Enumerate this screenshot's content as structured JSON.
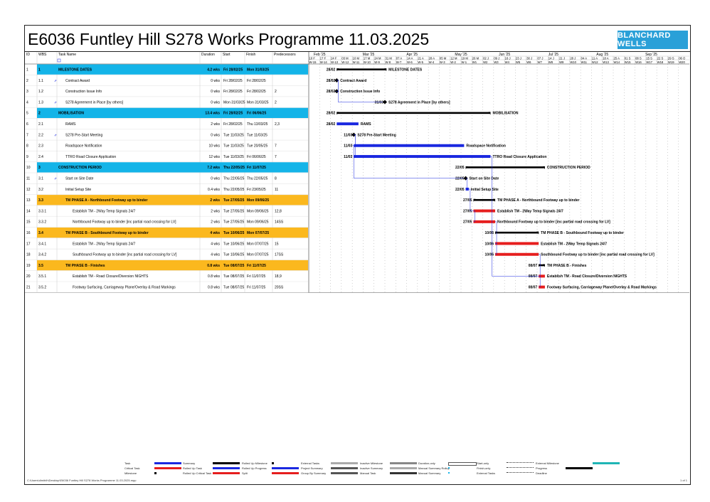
{
  "title": "E6036 Funtley Hill S278 Works Programme 11.03.2025",
  "logo_text": "BLANCHARD WELLS",
  "table_headers": {
    "id": "ID",
    "wbs": "WBS",
    "name": "Task Name",
    "duration": "Duration",
    "start": "Start",
    "finish": "Finish",
    "predecessors": "Predecessors"
  },
  "months": [
    "Feb '25",
    "Mar '25",
    "Apr '25",
    "May '25",
    "Jun '25",
    "Jul '25",
    "Aug '25",
    "Sep '25"
  ],
  "week_dates": [
    "10 F",
    "17 F",
    "24 F",
    "03 M",
    "10 M",
    "17 M",
    "24 M",
    "31 M",
    "07 A",
    "14 A",
    "21 A",
    "28 A",
    "05 M",
    "12 M",
    "19 M",
    "26 M",
    "02 J",
    "09 J",
    "16 J",
    "23 J",
    "30 J",
    "07 J",
    "14 J",
    "21 J",
    "28 J",
    "04 A",
    "11 A",
    "18 A",
    "25 A",
    "01 S",
    "08 S",
    "15 S",
    "22 S",
    "29 S",
    "06 O"
  ],
  "week_labels": [
    "W-15",
    "W-14",
    "W-13",
    "W-12",
    "W-11",
    "W-10",
    "W-9",
    "W-8",
    "W-7",
    "W-6",
    "W-5",
    "W-4",
    "W-3",
    "W-2",
    "W-1",
    "W1",
    "W2",
    "W3",
    "W4",
    "W5",
    "W6",
    "W7",
    "W8",
    "W9",
    "W10",
    "W11",
    "W12",
    "W13",
    "W14",
    "W15",
    "W16",
    "W17",
    "W18",
    "W19",
    "W20"
  ],
  "tasks": [
    {
      "id": "1",
      "wbs": "1",
      "name": "MILESTONE DATES",
      "duration": "4.2 wks",
      "start": "Fri 28/02/25",
      "finish": "Mon 31/03/25",
      "pred": "",
      "type": "summary-blue",
      "bar_label": "28/02",
      "label": "MILESTONE DATES"
    },
    {
      "id": "2",
      "wbs": "1.1",
      "name": "Contract Award",
      "duration": "0 wks",
      "start": "Fri 28/02/25",
      "finish": "Fri 28/02/25",
      "pred": "",
      "type": "milestone",
      "bar_label": "28/02",
      "label": "Contract Award"
    },
    {
      "id": "3",
      "wbs": "1.2",
      "name": "Construction Issue Info",
      "duration": "0 wks",
      "start": "Fri 28/02/25",
      "finish": "Fri 28/02/25",
      "pred": "2",
      "type": "milestone",
      "bar_label": "28/02",
      "label": "Construction Issue Info"
    },
    {
      "id": "4",
      "wbs": "1.3",
      "name": "S278 Agreement in Place [by others]",
      "duration": "0 wks",
      "start": "Mon 31/03/25",
      "finish": "Mon 31/03/25",
      "pred": "2",
      "type": "milestone",
      "bar_label": "31/03",
      "label": "S278 Agreement in Place [by others]"
    },
    {
      "id": "5",
      "wbs": "2",
      "name": "MOBILISATION",
      "duration": "13.4 wks",
      "start": "Fri 28/02/25",
      "finish": "Fri 06/06/25",
      "pred": "",
      "type": "summary-blue",
      "bar_label": "28/02",
      "label": "MOBILISATION"
    },
    {
      "id": "6",
      "wbs": "2.1",
      "name": "RAMS",
      "duration": "2 wks",
      "start": "Fri 28/02/25",
      "finish": "Thu 13/03/25",
      "pred": "2,3",
      "type": "task",
      "bar_label": "28/02",
      "label": "RAMS"
    },
    {
      "id": "7",
      "wbs": "2.2",
      "name": "S278 Pre-Start Meeting",
      "duration": "0 wks",
      "start": "Tue 11/03/25",
      "finish": "Tue 11/03/25",
      "pred": "",
      "type": "milestone",
      "bar_label": "11/03",
      "label": "S278 Pre-Start Meeting"
    },
    {
      "id": "8",
      "wbs": "2.3",
      "name": "Roadspace Notification",
      "duration": "10 wks",
      "start": "Tue 11/03/25",
      "finish": "Tue 20/05/25",
      "pred": "7",
      "type": "task",
      "bar_label": "11/03",
      "label": "Roadspace Notification"
    },
    {
      "id": "9",
      "wbs": "2.4",
      "name": "TTRO Road Closure Application",
      "duration": "12 wks",
      "start": "Tue 11/03/25",
      "finish": "Fri 06/06/25",
      "pred": "7",
      "type": "task",
      "bar_label": "11/03",
      "label": "TTRO Road Closure Application"
    },
    {
      "id": "10",
      "wbs": "3",
      "name": "CONSTRUCTION PERIOD",
      "duration": "7.2 wks",
      "start": "Thu 22/05/25",
      "finish": "Fri 11/07/25",
      "pred": "",
      "type": "summary-blue",
      "bar_label": "22/05",
      "label": "CONSTRUCTION PERIOD"
    },
    {
      "id": "11",
      "wbs": "3.1",
      "name": "Start on Site Date",
      "duration": "0 wks",
      "start": "Thu 22/05/25",
      "finish": "Thu 22/05/25",
      "pred": "8",
      "type": "milestone",
      "bar_label": "22/05",
      "label": "Start on Site Date"
    },
    {
      "id": "12",
      "wbs": "3.2",
      "name": "Initial Setup Site",
      "duration": "0.4 wks",
      "start": "Thu 22/05/25",
      "finish": "Fri 23/05/25",
      "pred": "11",
      "type": "task",
      "bar_label": "22/05",
      "label": "Initial Setup Site"
    },
    {
      "id": "13",
      "wbs": "3.3",
      "name": "TM PHASE A - Northbound Footway up to binder",
      "duration": "2 wks",
      "start": "Tue 27/05/25",
      "finish": "Mon 09/06/25",
      "pred": "",
      "type": "summary-orange",
      "bar_label": "27/05",
      "label": "TM PHASE A - Northbound Footway up to binder"
    },
    {
      "id": "14",
      "wbs": "3.3.1",
      "name": "Establish TM - 2Way Temp Signals 24/7",
      "duration": "2 wks",
      "start": "Tue 27/05/25",
      "finish": "Mon 09/06/25",
      "pred": "12,8",
      "type": "crit",
      "bar_label": "27/05",
      "label": "Establish TM - 2Way Temp Signals 24/7"
    },
    {
      "id": "15",
      "wbs": "3.3.2",
      "name": "Northbound Footway up to binder [inc partial road crossing for LV]",
      "duration": "2 wks",
      "start": "Tue 27/05/25",
      "finish": "Mon 09/06/25",
      "pred": "14SS",
      "type": "crit",
      "bar_label": "27/05",
      "label": "Northbound Footway up to binder [inc partial road crossing for LV]"
    },
    {
      "id": "16",
      "wbs": "3.4",
      "name": "TM PHASE B - Southbound Footway up to binder",
      "duration": "4 wks",
      "start": "Tue 10/06/25",
      "finish": "Mon 07/07/25",
      "pred": "",
      "type": "summary-orange",
      "bar_label": "10/06",
      "label": "TM PHASE B - Southbound Footway up to binder"
    },
    {
      "id": "17",
      "wbs": "3.4.1",
      "name": "Establish TM - 2Way Temp Signals 24/7",
      "duration": "4 wks",
      "start": "Tue 10/06/25",
      "finish": "Mon 07/07/25",
      "pred": "15",
      "type": "crit",
      "bar_label": "10/06",
      "label": "Establish TM - 2Way Temp Signals 24/7"
    },
    {
      "id": "18",
      "wbs": "3.4.2",
      "name": "Southbound Footway up to binder [inc partial road crossing for LV]",
      "duration": "4 wks",
      "start": "Tue 10/06/25",
      "finish": "Mon 07/07/25",
      "pred": "17SS",
      "type": "crit",
      "bar_label": "10/06",
      "label": "Southbound Footway up to binder [inc partial road crossing for LV]"
    },
    {
      "id": "19",
      "wbs": "3.5",
      "name": "TM PHASE B - Finishes",
      "duration": "0.8 wks",
      "start": "Tue 08/07/25",
      "finish": "Fri 11/07/25",
      "pred": "",
      "type": "summary-orange",
      "bar_label": "08/07",
      "label": "TM PHASE B - Finishes"
    },
    {
      "id": "20",
      "wbs": "3.5.1",
      "name": "Establish TM - Road Closure/Diversion NIGHTS",
      "duration": "0.8 wks",
      "start": "Tue 08/07/25",
      "finish": "Fri 11/07/25",
      "pred": "18,9",
      "type": "crit",
      "bar_label": "08/07",
      "label": "Establish TM - Road Closure/Diversion NIGHTS"
    },
    {
      "id": "21",
      "wbs": "3.5.2",
      "name": "Footway Surfacing, Carriageway Plane/Overlay & Road Markings",
      "duration": "0.8 wks",
      "start": "Tue 08/07/25",
      "finish": "Fri 11/07/25",
      "pred": "20SS",
      "type": "crit",
      "bar_label": "08/07",
      "label": "Footway Surfacing, Carriageway Plane/Overlay & Road Markings"
    }
  ],
  "legend": [
    [
      "Task",
      "Critical Task",
      "Milestone"
    ],
    [
      "Summary",
      "Rolled Up Task",
      "Rolled Up Critical Task"
    ],
    [
      "Rolled Up Milestone",
      "Rolled Up Progress",
      "Split"
    ],
    [
      "External Tasks",
      "Project Summary",
      "Group By Summary"
    ],
    [
      "Inactive Milestone",
      "Inactive Summary",
      "Manual Task"
    ],
    [
      "Duration-only",
      "Manual Summary Rollup",
      "Manual Summary"
    ],
    [
      "Start-only",
      "Finish-only",
      "External Tasks"
    ],
    [
      "External Milestone",
      "Progress",
      "Deadline"
    ]
  ],
  "footer_path": "C:\\Users\\dimitrih\\Desktop\\E6036 Funtley Hill S278 Works Programme 11.03.2025.mpp",
  "footer_page": "1 of 1",
  "colors": {
    "summary_blue": "#14b4e8",
    "summary_orange": "#fbb81e",
    "task_blue": "#1a28e0",
    "crit_red": "#e61e1e",
    "logo": "#2aa0d8"
  }
}
